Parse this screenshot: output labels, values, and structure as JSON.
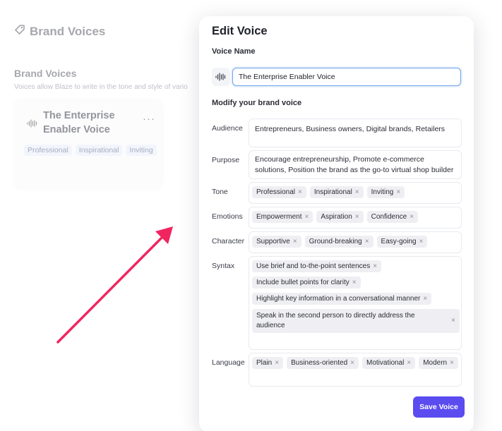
{
  "background": {
    "header_title": "Brand Voices",
    "section_title": "Brand Voices",
    "section_description": "Voices allow Blaze to write in the tone and style of vario",
    "card": {
      "title": "The Enterprise Enabler Voice",
      "more": "···",
      "tags": [
        "Professional",
        "Inspirational",
        "Inviting"
      ]
    }
  },
  "modal": {
    "title": "Edit Voice",
    "voice_name_label": "Voice Name",
    "voice_name_value": "The Enterprise Enabler Voice",
    "modify_label": "Modify your brand voice",
    "fields": {
      "audience": {
        "label": "Audience",
        "value": "Entrepreneurs, Business owners, Digital brands, Retailers"
      },
      "purpose": {
        "label": "Purpose",
        "value": "Encourage entrepreneurship, Promote e-commerce solutions, Position the brand as the go-to virtual shop builder"
      },
      "tone": {
        "label": "Tone",
        "chips": [
          "Professional",
          "Inspirational",
          "Inviting"
        ]
      },
      "emotions": {
        "label": "Emotions",
        "chips": [
          "Empowerment",
          "Aspiration",
          "Confidence"
        ]
      },
      "character": {
        "label": "Character",
        "chips": [
          "Supportive",
          "Ground-breaking",
          "Easy-going"
        ]
      },
      "syntax": {
        "label": "Syntax",
        "chips": [
          "Use brief and to-the-point sentences",
          "Include bullet points for clarity",
          "Highlight key information in a conversational manner",
          "Speak in the second person to directly address the audience"
        ]
      },
      "language": {
        "label": "Language",
        "chips": [
          "Plain",
          "Business-oriented",
          "Motivational",
          "Modern"
        ]
      }
    },
    "remove_glyph": "×",
    "save_label": "Save Voice"
  },
  "colors": {
    "accent": "#5b4cf0",
    "arrow": "#f0255f",
    "input_focus": "#6ea3e8"
  },
  "icons": {
    "header": "tag-icon",
    "voice": "soundwave-icon"
  }
}
